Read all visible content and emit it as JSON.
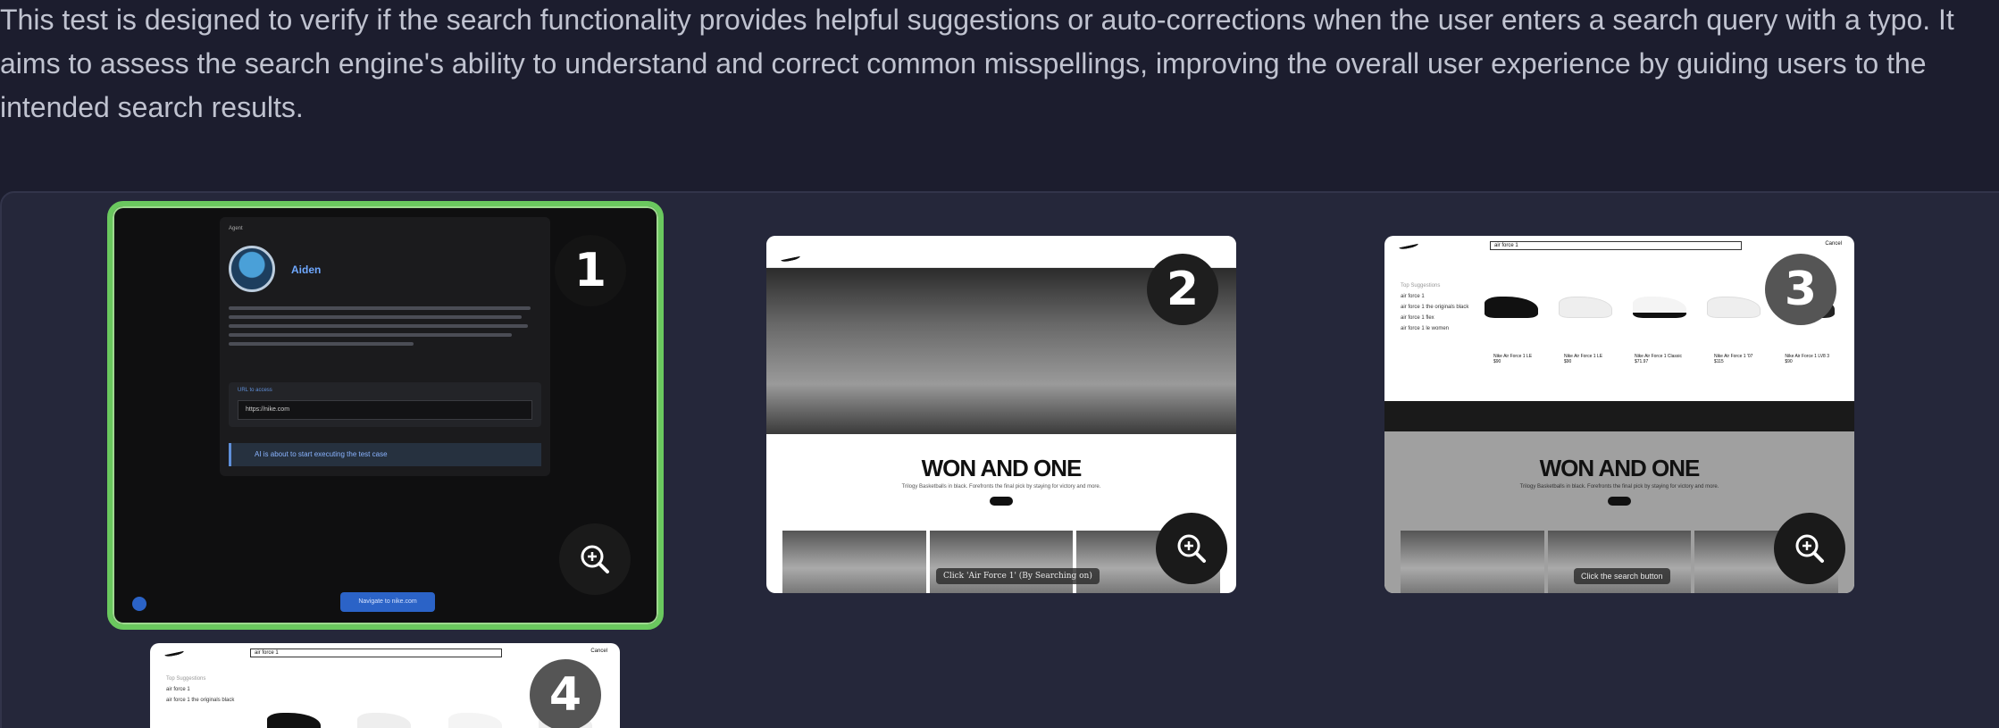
{
  "description": {
    "line1": "This test is designed to verify if the search functionality provides helpful suggestions or auto-corrections when the user enters a search query with a typo. It",
    "line2": "aims to assess the search engine's ability to understand and correct common misspellings, improving the overall user experience by guiding users to the",
    "line3": "intended search results."
  },
  "screenshots": [
    {
      "number": "1",
      "agent_label": "Agent",
      "agent_name": "Aiden",
      "url_label": "URL to access",
      "url_value": "https://nike.com",
      "status_text": "AI is about to start executing the test case",
      "nav_button": "Navigate to nike.com",
      "selected": true,
      "zoom_icon": "zoom-in-icon"
    },
    {
      "number": "2",
      "headline": "WON AND ONE",
      "subline": "Trilogy Basketballs in black. Forefronts the final pick by staying for victory and more.",
      "pill": "Shop",
      "caption": "Click 'Air Force 1' (By Searching on)",
      "zoom_icon": "zoom-in-icon"
    },
    {
      "number": "3",
      "search_text": "air force 1",
      "cancel": "Cancel",
      "suggestions_title": "Top Suggestions",
      "suggestions": [
        "air force 1",
        "air force 1 the originals black",
        "air force 1 flex",
        "air force 1 le women"
      ],
      "headline": "WON AND ONE",
      "subline": "Trilogy Basketballs in black. Forefronts the final pick by staying for victory and more.",
      "pill": "Shop",
      "caption": "Click the search button",
      "products": [
        {
          "name": "Nike Air Force 1 LE",
          "price": "$90"
        },
        {
          "name": "Nike Air Force 1 LE",
          "price": "$90"
        },
        {
          "name": "Nike Air Force 1 Classic",
          "price": "$71.97"
        },
        {
          "name": "Nike Air Force 1 '07",
          "price": "$115"
        },
        {
          "name": "Nike Air Force 1 LV8 3",
          "price": "$90"
        }
      ],
      "zoom_icon": "zoom-in-icon"
    },
    {
      "number": "4",
      "search_text": "air force 1",
      "cancel": "Cancel",
      "suggestions_title": "Top Suggestions",
      "suggestions": [
        "air force 1",
        "air force 1 the originals black"
      ]
    }
  ],
  "colors": {
    "background": "#1c1d2e",
    "panel": "#25273a",
    "selected_border": "#6ac85e",
    "text": "#c0c3d0"
  }
}
